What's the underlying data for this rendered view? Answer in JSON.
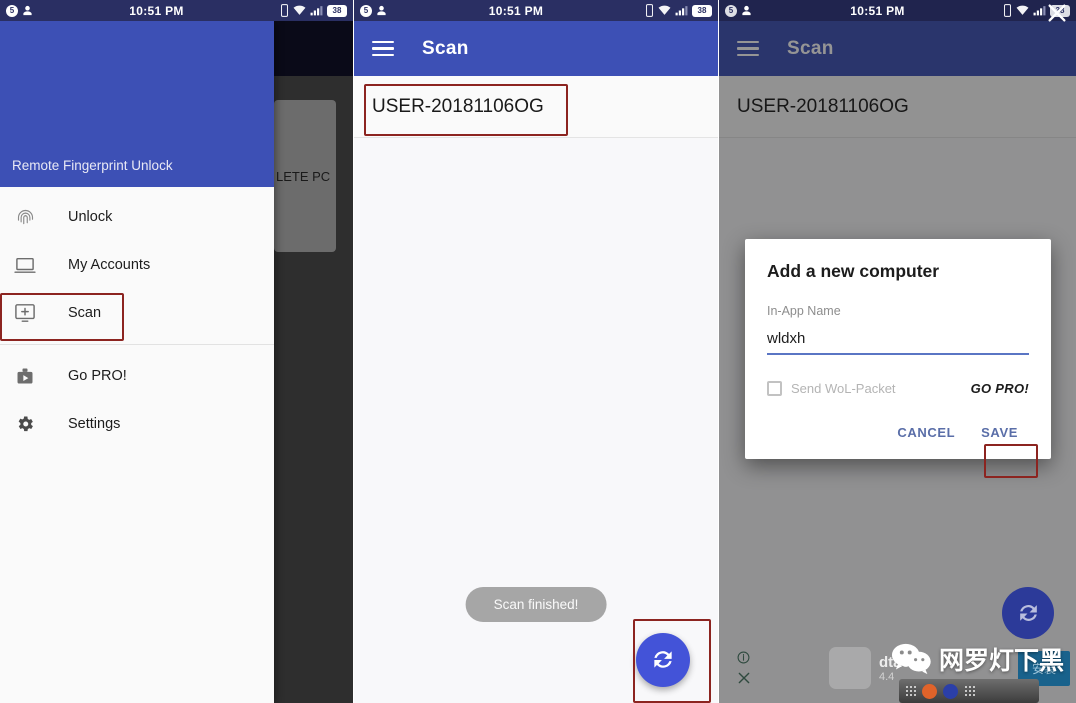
{
  "statusbar": {
    "time": "10:51 PM",
    "battery": "38",
    "notification_count": "5",
    "icons": [
      "clock-badge-icon",
      "person-icon",
      "vibrate-icon",
      "wifi-icon",
      "signal-icon",
      "battery-icon"
    ]
  },
  "panel1": {
    "drawer": {
      "header_title": "Remote Fingerprint Unlock",
      "items": [
        {
          "label": "Unlock",
          "icon": "fingerprint-icon"
        },
        {
          "label": "My Accounts",
          "icon": "laptop-icon"
        },
        {
          "label": "Scan",
          "icon": "add-screen-icon",
          "highlighted": true
        },
        {
          "label": "Go PRO!",
          "icon": "briefcase-play-icon"
        },
        {
          "label": "Settings",
          "icon": "gear-icon"
        }
      ]
    },
    "background_card_text": "LETE PC"
  },
  "panel2": {
    "appbar": {
      "title": "Scan",
      "menu_icon": "hamburger-icon"
    },
    "scan_result": "USER-20181106OG",
    "toast": "Scan finished!",
    "fab": {
      "icon": "refresh-icon",
      "color": "#4353d8"
    }
  },
  "panel3": {
    "appbar": {
      "title": "Scan",
      "menu_icon": "hamburger-icon"
    },
    "scan_result": "USER-20181106OG",
    "dialog": {
      "title": "Add a new computer",
      "field_label": "In-App Name",
      "field_value": "wldxh",
      "field_placeholder": "In-App Name",
      "checkbox_label": "Send WoL-Packet",
      "pro_badge": "GO PRO!",
      "cancel_label": "CANCEL",
      "save_label": "SAVE"
    },
    "fab": {
      "icon": "refresh-icon"
    },
    "ad": {
      "name": "dtac",
      "rating": "4.4",
      "install_label": "安装"
    },
    "watermark": "网罗灯下黑",
    "close_icon": "close-icon",
    "overlay_icons": [
      "info-icon",
      "close-small-icon"
    ]
  },
  "annotations": {
    "color": "#8c2420",
    "boxes": [
      "drawer-scan-item",
      "scan-result-row",
      "scan-fab",
      "dialog-save-button"
    ]
  }
}
